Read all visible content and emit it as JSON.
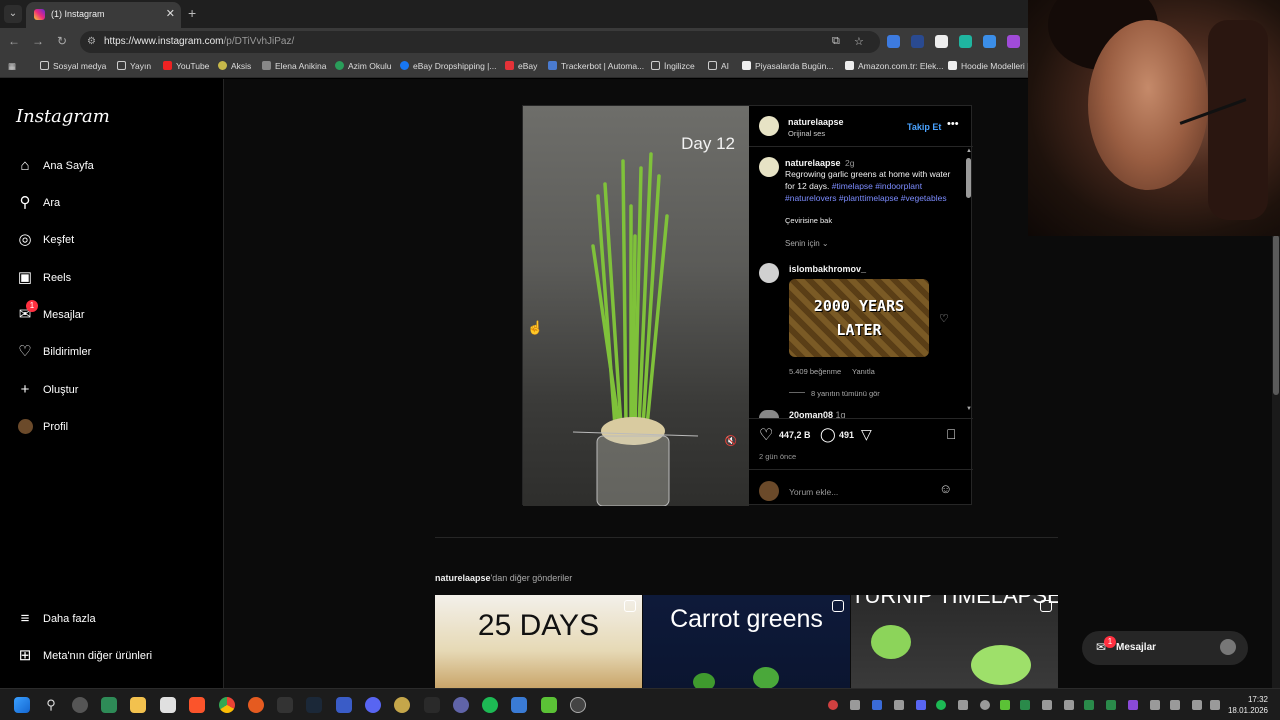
{
  "browser": {
    "tab_title": "(1) Instagram",
    "url_host": "https://www.instagram.com",
    "url_path": "/p/DTiVvhJiPaz/",
    "bookmarks": [
      "Sosyal medya",
      "Yayın",
      "YouTube",
      "Aksis",
      "Elena Anikina",
      "Azim Okulu",
      "eBay Dropshipping |...",
      "eBay",
      "Trackerbot | Automa...",
      "İngilizce",
      "AI",
      "Piyasalarda Bugün...",
      "Amazon.com.tr: Elek...",
      "Hoodie Modelleri |..."
    ]
  },
  "sidebar": {
    "logo": "Instagram",
    "items": [
      {
        "label": "Ana Sayfa",
        "icon": "home-icon"
      },
      {
        "label": "Ara",
        "icon": "search-icon"
      },
      {
        "label": "Keşfet",
        "icon": "compass-icon"
      },
      {
        "label": "Reels",
        "icon": "reels-icon"
      },
      {
        "label": "Mesajlar",
        "icon": "messenger-icon",
        "badge": "1"
      },
      {
        "label": "Bildirimler",
        "icon": "heart-icon"
      },
      {
        "label": "Oluştur",
        "icon": "plus-icon"
      },
      {
        "label": "Profil",
        "icon": "profile-avatar"
      }
    ],
    "more": "Daha fazla",
    "meta": "Meta'nın diğer ürünleri"
  },
  "post": {
    "video_label": "Day 12",
    "username": "naturelaapse",
    "audio": "Orijinal ses",
    "follow": "Takip Et",
    "caption_user": "naturelaapse",
    "caption_time": "2g",
    "caption_text": "Regrowing garlic greens at home with water for 12 days.",
    "hashtags": "#timelapse #indoorplant #naturelovers #planttimelapse #vegetables",
    "translate": "Çevirisine bak",
    "sort": "Senin için",
    "comment": {
      "user": "islombakhromov_",
      "image_line1": "2000 YEARS",
      "image_line2": "LATER",
      "likes": "5.409 beğenme",
      "reply": "Yanıtla",
      "view_replies": "8 yanıtın tümünü gör"
    },
    "next_comment_user": "20oman08",
    "next_comment_time": "1g",
    "like_count": "447,2 B",
    "comment_count": "491",
    "date": "2 gün önce",
    "comment_placeholder": "Yorum ekle..."
  },
  "more_posts": {
    "title_user": "naturelaapse",
    "title_rest": "'dan diğer gönderiler",
    "thumbs": [
      "25 DAYS",
      "Carrot greens",
      "TURNIP TIMELAPSE"
    ]
  },
  "messages_pill": {
    "label": "Mesajlar",
    "badge": "1"
  },
  "taskbar": {
    "time": "17:32",
    "date": "18.01.2026"
  },
  "colors": {
    "accent_blue": "#4aa3ff",
    "hashtag": "#7c8cff",
    "badge_red": "#ff3040"
  }
}
